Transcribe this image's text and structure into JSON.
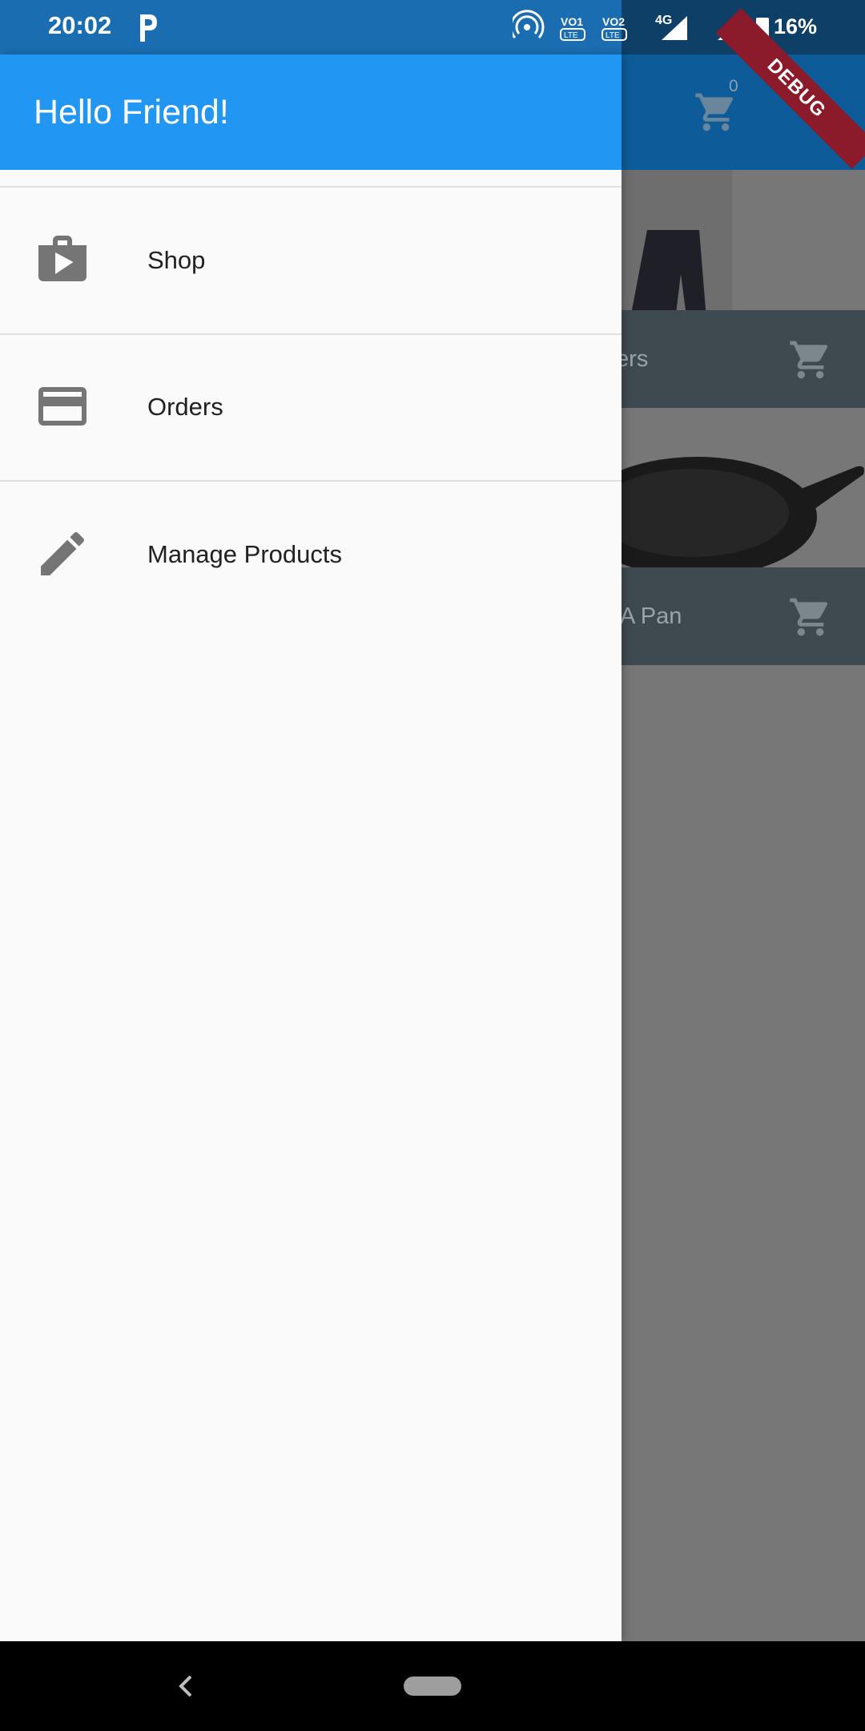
{
  "status_bar": {
    "time": "20:02",
    "battery": "16%",
    "network": "4G",
    "icons": [
      "p-icon",
      "hotspot-icon",
      "volte-1-icon",
      "volte-2-icon",
      "signal-4g-icon",
      "signal-no-sim-icon",
      "battery-charging-icon"
    ]
  },
  "debug_banner": "DEBUG",
  "background": {
    "cart_count": "0",
    "products": [
      {
        "title": "Trousers"
      },
      {
        "title": "A Pan"
      }
    ]
  },
  "drawer": {
    "title": "Hello Friend!",
    "items": [
      {
        "label": "Shop",
        "icon": "shop-icon"
      },
      {
        "label": "Orders",
        "icon": "credit-card-icon"
      },
      {
        "label": "Manage Products",
        "icon": "edit-icon"
      }
    ]
  },
  "colors": {
    "primary": "#2196F3",
    "icon_grey": "#757575",
    "drawer_bg": "#FAFAFA"
  }
}
